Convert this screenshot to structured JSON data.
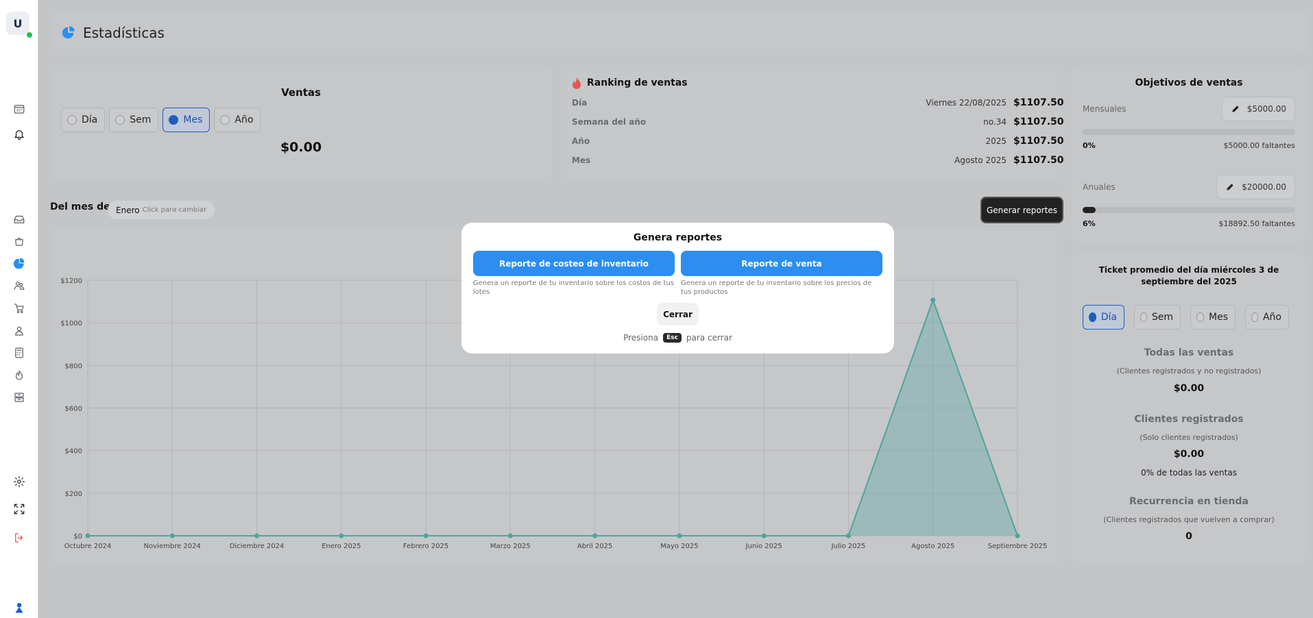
{
  "sidebar": {
    "avatar_initial": "U",
    "icons": [
      "calendar-icon",
      "bell-icon",
      "inbox-icon",
      "bag-icon",
      "pie-chart-icon",
      "users-icon",
      "cart-icon",
      "user-icon",
      "calculator-icon",
      "fire-icon",
      "archive-icon",
      "gear-icon",
      "expand-icon",
      "logout-icon",
      "person-icon"
    ]
  },
  "header": {
    "title": "Estadísticas",
    "accent": "#2b8ef0"
  },
  "ventas": {
    "title": "Ventas",
    "options": [
      "Día",
      "Sem",
      "Mes",
      "Año"
    ],
    "selected": "Mes",
    "amount": "$0.00"
  },
  "ranking": {
    "title": "Ranking de ventas",
    "rows": [
      {
        "label": "Día",
        "value": "Viernes 22/08/2025",
        "amount": "$1107.50"
      },
      {
        "label": "Semana del año",
        "value": "no.34",
        "amount": "$1107.50"
      },
      {
        "label": "Año",
        "value": "2025",
        "amount": "$1107.50"
      },
      {
        "label": "Mes",
        "value": "Agosto 2025",
        "amount": "$1107.50"
      }
    ]
  },
  "objetivos": {
    "title": "Objetivos de ventas",
    "mensuales": {
      "label": "Mensuales",
      "goal": "$5000.00",
      "pct": "0%",
      "progress": 0.0,
      "remaining": "$5000.00 faltantes"
    },
    "anuales": {
      "label": "Anuales",
      "goal": "$20000.00",
      "pct": "6%",
      "progress": 0.06,
      "remaining": "$18892.50 faltantes"
    }
  },
  "ticket": {
    "title": "Ticket promedio del día miércoles 3 de septiembre del 2025",
    "options": [
      "Día",
      "Sem",
      "Mes",
      "Año"
    ],
    "selected": "Día",
    "todas_title": "Todas las ventas",
    "todas_sub": "(Clientes registrados y no registrados)",
    "todas_val": "$0.00",
    "reg_title": "Clientes registrados",
    "reg_sub": "(Solo clientes registrados)",
    "reg_val": "$0.00",
    "reg_note": "0% de todas las ventas",
    "rec_title": "Recurrencia en tienda",
    "rec_sub": "(Clientes registrados que vuelven a comprar)",
    "rec_val": "0"
  },
  "month_filter": {
    "label": "Del mes de",
    "value": "Enero",
    "hint": "Click para cambiar"
  },
  "generate_button": "Generar reportes",
  "chart_data": {
    "type": "area",
    "categories": [
      "Octubre 2024",
      "Noviembre 2024",
      "Diciembre 2024",
      "Enero 2025",
      "Febrero 2025",
      "Marzo 2025",
      "Abril 2025",
      "Mayo 2025",
      "Junio 2025",
      "Julio 2025",
      "Agosto 2025",
      "Septiembre 2025"
    ],
    "values": [
      0,
      0,
      0,
      0,
      0,
      0,
      0,
      0,
      0,
      0,
      1107.5,
      0
    ],
    "y_ticks": [
      "$0",
      "$200",
      "$400",
      "$600",
      "$800",
      "$1000",
      "$1200"
    ],
    "ylim": [
      0,
      1200
    ],
    "grid": true,
    "color": "#4fa39e"
  },
  "modal": {
    "title": "Genera reportes",
    "btn_inventory": "Reporte de costeo de inventario",
    "desc_inventory": "Genera un reporte de tu inventario sobre los costos de tus lotes",
    "btn_sales": "Reporte de venta",
    "desc_sales": "Genera un reporte de tu inventario sobre los precios de tus productos",
    "close": "Cerrar",
    "press": "Presiona",
    "esc": "Esc",
    "to_close": "para cerrar"
  }
}
